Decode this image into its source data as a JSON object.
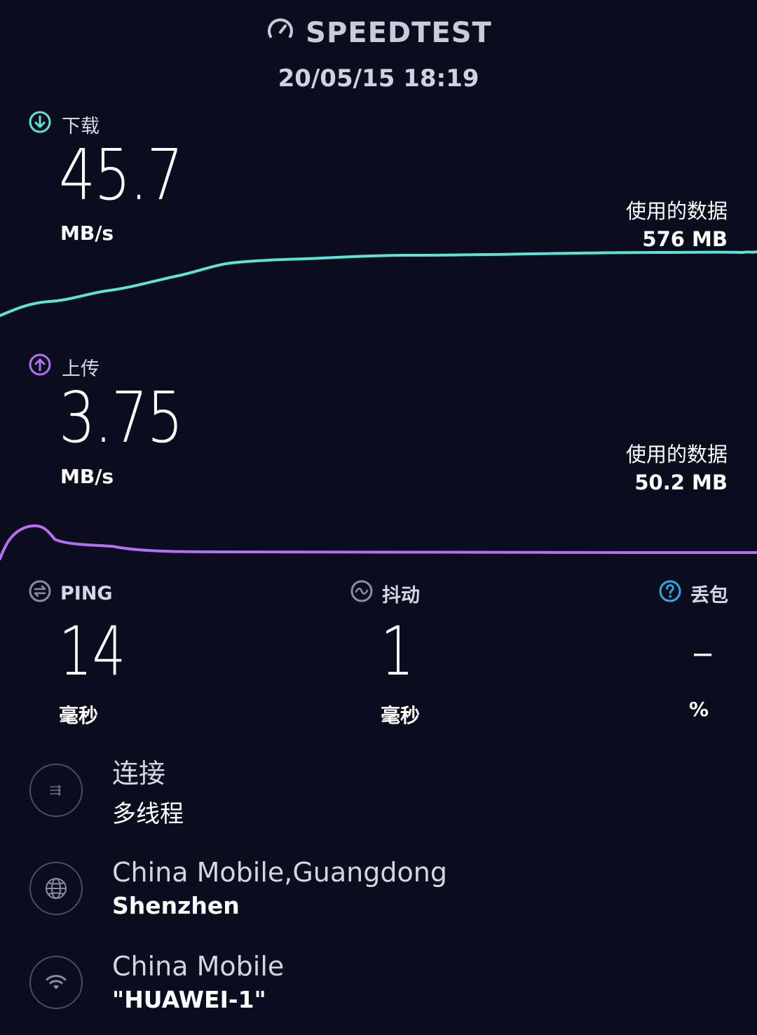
{
  "header": {
    "brand": "SPEEDTEST",
    "datetime": "20/05/15 18:19",
    "icon": "speedometer-icon"
  },
  "download": {
    "label": "下载",
    "value": "45.7",
    "unit": "MB/s",
    "data_used_label": "使用的数据",
    "data_used_value": "576 MB",
    "color": "#5de3d6",
    "icon": "download-arrow-icon"
  },
  "upload": {
    "label": "上传",
    "value": "3.75",
    "unit": "MB/s",
    "data_used_label": "使用的数据",
    "data_used_value": "50.2 MB",
    "color": "#b470f0",
    "icon": "upload-arrow-icon"
  },
  "ping": {
    "label": "PING",
    "value": "14",
    "unit": "毫秒",
    "icon": "ping-icon"
  },
  "jitter": {
    "label": "抖动",
    "value": "1",
    "unit": "毫秒",
    "icon": "jitter-icon"
  },
  "packet_loss": {
    "label": "丢包",
    "value": "–",
    "unit": "%",
    "color": "#2fa8e6",
    "icon": "question-icon"
  },
  "connection": {
    "title": "连接",
    "subtitle": "多线程",
    "icon": "multi-connection-icon"
  },
  "server": {
    "title": "China Mobile,Guangdong",
    "subtitle": "Shenzhen",
    "icon": "globe-icon"
  },
  "network": {
    "title": "China Mobile",
    "subtitle": "\"HUAWEI-1\"",
    "icon": "wifi-icon"
  }
}
